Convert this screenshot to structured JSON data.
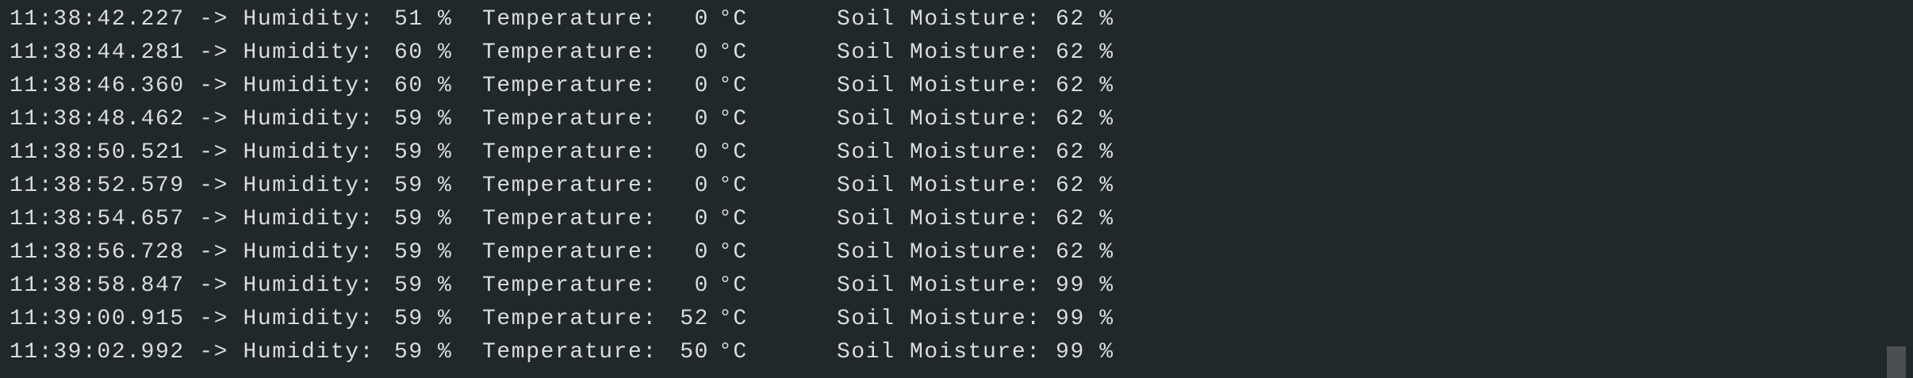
{
  "labels": {
    "humidity": "Humidity:",
    "temperature": "Temperature:",
    "soil": "Soil Moisture:",
    "arrow": "->",
    "percent": "%",
    "celsius": "°C"
  },
  "rows": [
    {
      "time": "11:38:42.227",
      "humidity": "51",
      "temperature": "0",
      "soil": "62"
    },
    {
      "time": "11:38:44.281",
      "humidity": "60",
      "temperature": "0",
      "soil": "62"
    },
    {
      "time": "11:38:46.360",
      "humidity": "60",
      "temperature": "0",
      "soil": "62"
    },
    {
      "time": "11:38:48.462",
      "humidity": "59",
      "temperature": "0",
      "soil": "62"
    },
    {
      "time": "11:38:50.521",
      "humidity": "59",
      "temperature": "0",
      "soil": "62"
    },
    {
      "time": "11:38:52.579",
      "humidity": "59",
      "temperature": "0",
      "soil": "62"
    },
    {
      "time": "11:38:54.657",
      "humidity": "59",
      "temperature": "0",
      "soil": "62"
    },
    {
      "time": "11:38:56.728",
      "humidity": "59",
      "temperature": "0",
      "soil": "62"
    },
    {
      "time": "11:38:58.847",
      "humidity": "59",
      "temperature": "0",
      "soil": "99"
    },
    {
      "time": "11:39:00.915",
      "humidity": "59",
      "temperature": "52",
      "soil": "99"
    },
    {
      "time": "11:39:02.992",
      "humidity": "59",
      "temperature": "50",
      "soil": "99"
    }
  ]
}
